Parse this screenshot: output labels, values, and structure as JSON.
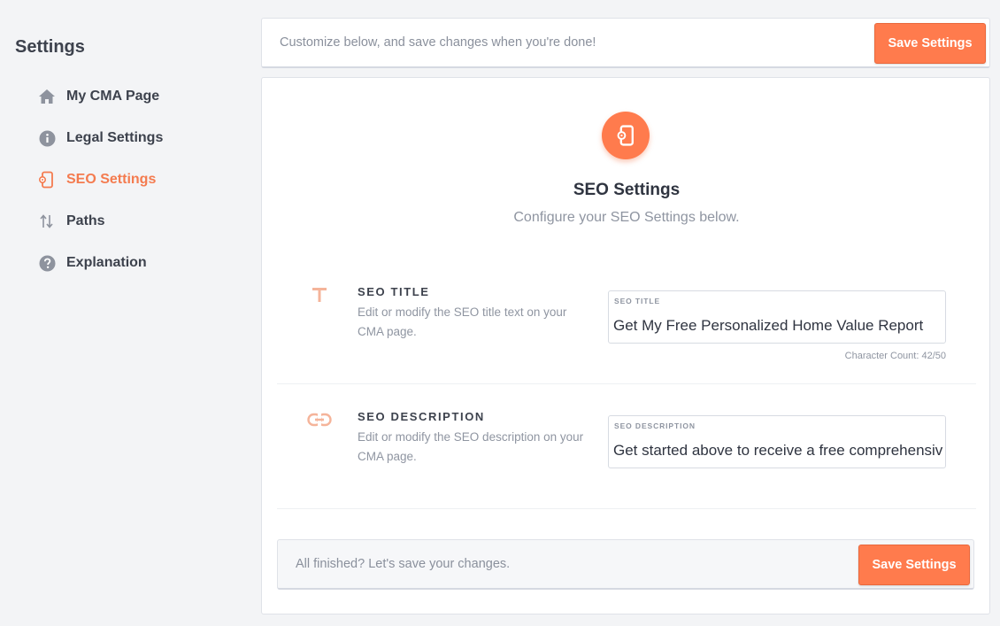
{
  "sidebar": {
    "title": "Settings",
    "items": [
      {
        "label": "My CMA Page",
        "icon": "home-icon"
      },
      {
        "label": "Legal Settings",
        "icon": "info-icon"
      },
      {
        "label": "SEO Settings",
        "icon": "seo-device-icon",
        "active": true
      },
      {
        "label": "Paths",
        "icon": "sort-arrows-icon"
      },
      {
        "label": "Explanation",
        "icon": "question-icon"
      }
    ]
  },
  "topbar": {
    "text": "Customize below, and save changes when you're done!",
    "save_label": "Save Settings"
  },
  "card": {
    "icon": "seo-device-icon",
    "title": "SEO Settings",
    "subtitle": "Configure your SEO Settings below.",
    "sections": [
      {
        "icon": "text-t-icon",
        "label": "SEO TITLE",
        "description": "Edit or modify the SEO title text on your CMA page.",
        "field_label": "SEO TITLE",
        "value": "Get My Free Personalized Home Value Report",
        "char_count": "Character Count: 42/50"
      },
      {
        "icon": "link-icon",
        "label": "SEO DESCRIPTION",
        "description": "Edit or modify the SEO description on your CMA page.",
        "field_label": "SEO DESCRIPTION",
        "value": "Get started above to receive a free comprehensive home value report."
      }
    ]
  },
  "bottombar": {
    "text": "All finished? Let's save your changes.",
    "save_label": "Save Settings"
  },
  "colors": {
    "accent": "#ff7b4d",
    "active_text": "#f47b4f",
    "muted_icon": "#8e939e",
    "soft_accent": "#f5b49a"
  }
}
